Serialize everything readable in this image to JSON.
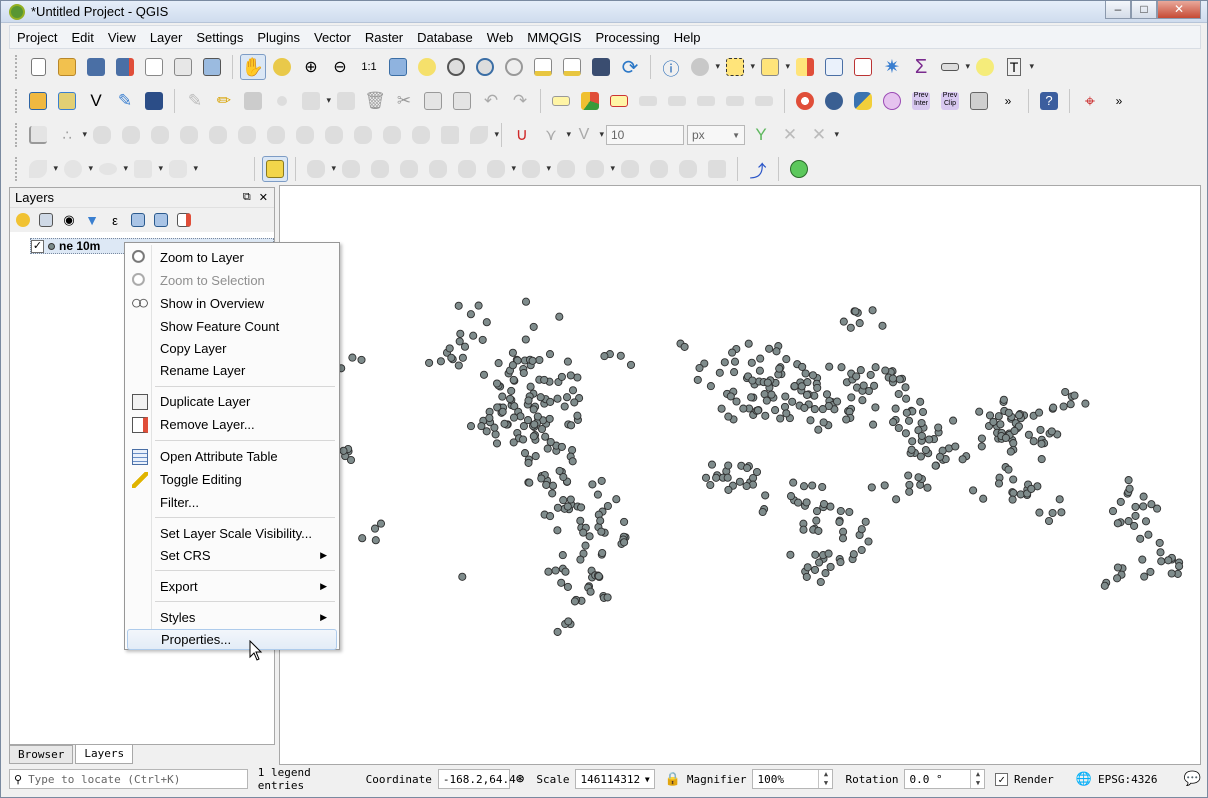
{
  "window": {
    "title": "*Untitled Project - QGIS"
  },
  "menubar": [
    "Project",
    "Edit",
    "View",
    "Layer",
    "Settings",
    "Plugins",
    "Vector",
    "Raster",
    "Database",
    "Web",
    "MMQGIS",
    "Processing",
    "Help"
  ],
  "toolbar": {
    "width_value": "10",
    "unit_value": "px"
  },
  "layers_panel": {
    "title": "Layers",
    "layer_name": "ne 10m",
    "layer_checked": true,
    "tabs": [
      "Browser",
      "Layers"
    ]
  },
  "context_menu": {
    "items": [
      {
        "label": "Zoom to Layer",
        "icon": "zoom-layer-icon",
        "disabled": false
      },
      {
        "label": "Zoom to Selection",
        "icon": "zoom-selection-icon",
        "disabled": true
      },
      {
        "label": "Show in Overview",
        "icon": "overview-glasses-icon",
        "disabled": false
      },
      {
        "label": "Show Feature Count",
        "icon": "",
        "disabled": false
      },
      {
        "label": "Copy Layer",
        "icon": "",
        "disabled": false
      },
      {
        "label": "Rename Layer",
        "icon": "",
        "disabled": false
      },
      {
        "label": "Duplicate Layer",
        "icon": "duplicate-layer-icon",
        "disabled": false
      },
      {
        "label": "Remove Layer...",
        "icon": "remove-layer-icon",
        "disabled": false
      },
      {
        "label": "Open Attribute Table",
        "icon": "attribute-table-icon",
        "disabled": false
      },
      {
        "label": "Toggle Editing",
        "icon": "pencil-icon",
        "disabled": false
      },
      {
        "label": "Filter...",
        "icon": "",
        "disabled": false
      },
      {
        "label": "Set Layer Scale Visibility...",
        "icon": "",
        "disabled": false
      },
      {
        "label": "Set CRS",
        "icon": "",
        "disabled": false,
        "submenu": true
      },
      {
        "label": "Export",
        "icon": "",
        "disabled": false,
        "submenu": true
      },
      {
        "label": "Styles",
        "icon": "",
        "disabled": false,
        "submenu": true
      },
      {
        "label": "Properties...",
        "icon": "",
        "disabled": false,
        "hover": true
      }
    ]
  },
  "statusbar": {
    "locate_placeholder": "Type to locate (Ctrl+K)",
    "legend_entries": "1 legend entries",
    "coordinate_label": "Coordinate",
    "coordinate_value": "-168.2,64.4",
    "scale_label": "Scale",
    "scale_value": "146114312",
    "magnifier_label": "Magnifier",
    "magnifier_value": "100%",
    "rotation_label": "Rotation",
    "rotation_value": "0.0 °",
    "render_label": "Render",
    "render_checked": true,
    "crs": "EPSG:4326"
  },
  "colors": {
    "point_fill": "#7f8c8c",
    "point_stroke": "#2f2f2f",
    "accent": "#3399ff"
  }
}
